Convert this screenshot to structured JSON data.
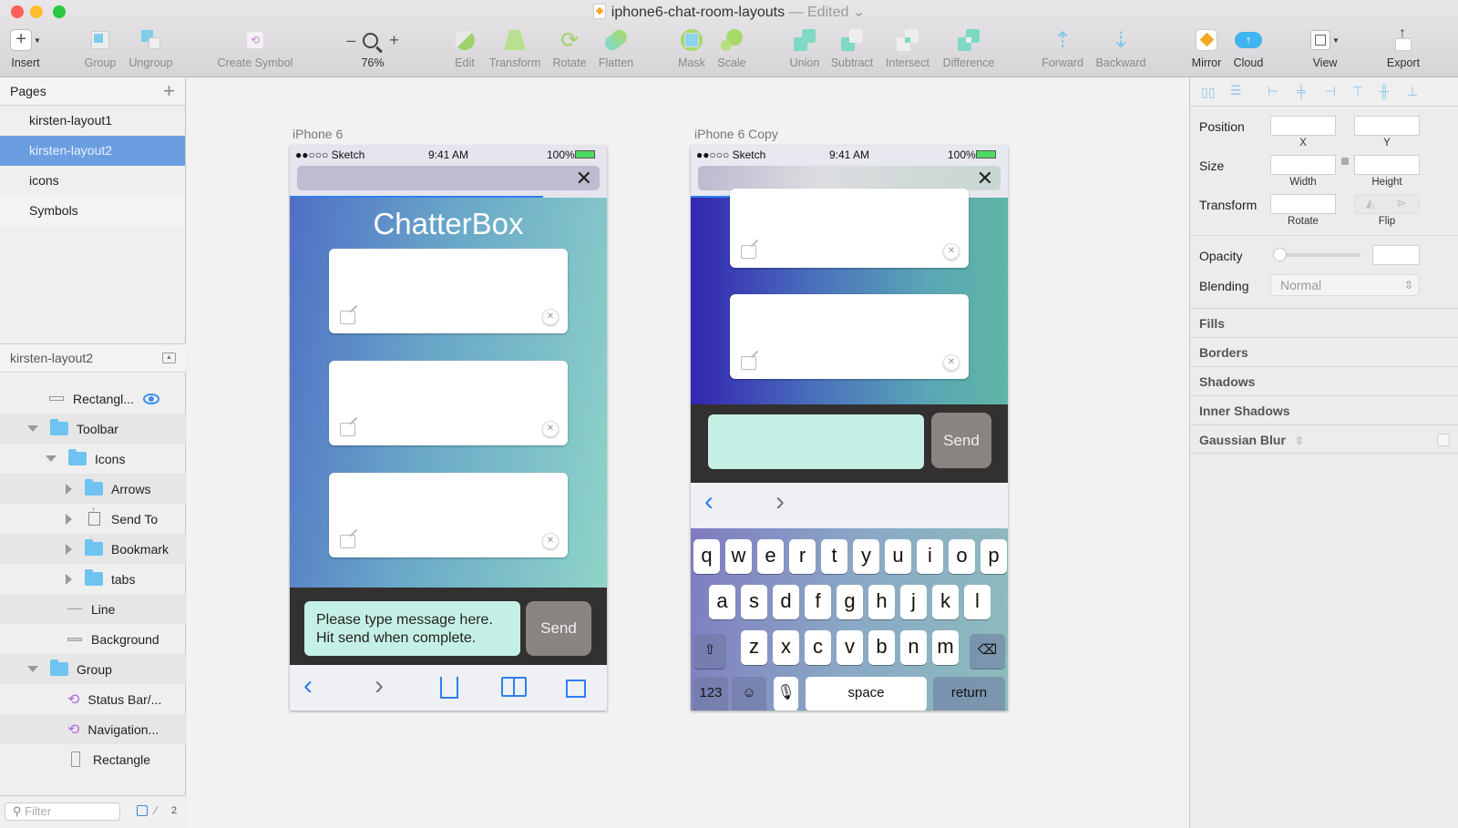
{
  "window": {
    "title": "iphone6-chat-room-layouts",
    "status": "— Edited",
    "traffic_colors": {
      "close": "#fd5f57",
      "minimize": "#fdbc2e",
      "zoom": "#28c840"
    }
  },
  "toolbar": {
    "insert": "Insert",
    "group": "Group",
    "ungroup": "Ungroup",
    "create_symbol": "Create Symbol",
    "zoom_level": "76%",
    "zoom_minus": "–",
    "zoom_plus": "+",
    "edit": "Edit",
    "transform": "Transform",
    "rotate": "Rotate",
    "flatten": "Flatten",
    "mask": "Mask",
    "scale": "Scale",
    "union": "Union",
    "subtract": "Subtract",
    "intersect": "Intersect",
    "difference": "Difference",
    "forward": "Forward",
    "backward": "Backward",
    "mirror": "Mirror",
    "cloud": "Cloud",
    "view": "View",
    "export": "Export"
  },
  "pages": {
    "header": "Pages",
    "items": [
      {
        "label": "kirsten-layout1",
        "selected": false
      },
      {
        "label": "kirsten-layout2",
        "selected": true
      },
      {
        "label": "icons",
        "selected": false
      },
      {
        "label": "Symbols",
        "selected": false
      }
    ]
  },
  "layers": {
    "header": "kirsten-layout2",
    "items": [
      {
        "label": "Rectangl...",
        "icon": "rectangle-icon",
        "visible_eye": true
      },
      {
        "label": "Toolbar",
        "icon": "folder-icon",
        "expanded": true
      },
      {
        "label": "Icons",
        "icon": "folder-icon",
        "expanded": true
      },
      {
        "label": "Arrows",
        "icon": "folder-icon",
        "expanded": false
      },
      {
        "label": "Send To",
        "icon": "share-icon",
        "expanded": false
      },
      {
        "label": "Bookmark",
        "icon": "folder-icon",
        "expanded": false
      },
      {
        "label": "tabs",
        "icon": "folder-icon",
        "expanded": false
      },
      {
        "label": "Line",
        "icon": "line-icon"
      },
      {
        "label": "Background",
        "icon": "rectangle-icon"
      },
      {
        "label": "Group",
        "icon": "folder-icon",
        "expanded": true
      },
      {
        "label": "Status Bar/...",
        "icon": "symbol-icon"
      },
      {
        "label": "Navigation...",
        "icon": "symbol-icon"
      },
      {
        "label": "Rectangle",
        "icon": "rectangle-outline-icon"
      }
    ],
    "filter_placeholder": "Filter",
    "pages_count": "2"
  },
  "artboards": [
    {
      "label": "iPhone 6",
      "status": {
        "carrier": "●●○○○ Sketch",
        "time": "9:41 AM",
        "battery": "100%"
      },
      "app_title": "ChatterBox",
      "message_placeholder": "Please type message here.\nHit send when complete.",
      "send_label": "Send",
      "card_count": 3
    },
    {
      "label": "iPhone 6 Copy",
      "status": {
        "carrier": "●●○○○ Sketch",
        "time": "9:41 AM",
        "battery": "100%"
      },
      "send_label": "Send",
      "keyboard": {
        "row1": [
          "q",
          "w",
          "e",
          "r",
          "t",
          "y",
          "u",
          "i",
          "o",
          "p"
        ],
        "row2": [
          "a",
          "s",
          "d",
          "f",
          "g",
          "h",
          "j",
          "k",
          "l"
        ],
        "row3": [
          "z",
          "x",
          "c",
          "v",
          "b",
          "n",
          "m"
        ],
        "numbers": "123",
        "space": "space",
        "return": "return"
      }
    }
  ],
  "inspector": {
    "position": "Position",
    "x": "X",
    "y": "Y",
    "size": "Size",
    "width": "Width",
    "height": "Height",
    "transform": "Transform",
    "rotate": "Rotate",
    "flip": "Flip",
    "opacity": "Opacity",
    "opacity_value": 0,
    "blending": "Blending",
    "blending_value": "Normal",
    "sections": [
      "Fills",
      "Borders",
      "Shadows",
      "Inner Shadows"
    ],
    "gaussian_blur": "Gaussian Blur"
  }
}
